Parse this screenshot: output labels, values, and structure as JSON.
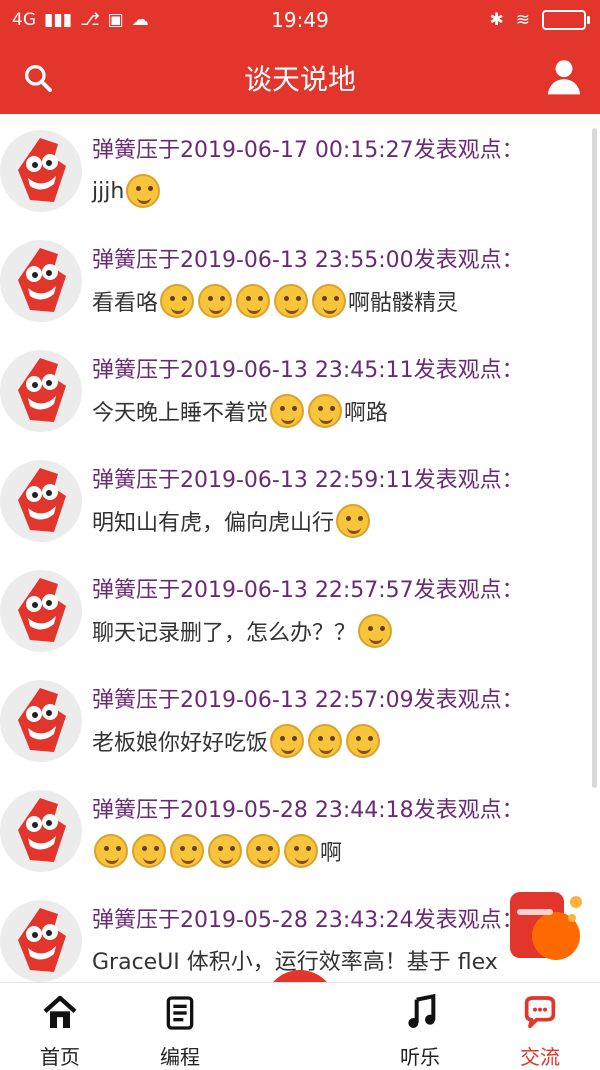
{
  "status_bar": {
    "network": "4G",
    "time": "19:49"
  },
  "header": {
    "title": "谈天说地"
  },
  "posts": [
    {
      "meta": "弹簧压于2019-06-17 00:15:27发表观点：",
      "text": "jjjh",
      "emoji_after": [
        "confused-face"
      ]
    },
    {
      "meta": "弹簧压于2019-06-13 23:55:00发表观点：",
      "text_before": "看看咯",
      "emoji_after": [
        "smile-face",
        "grin-face",
        "smile-face",
        "confused-face",
        "confused-face"
      ],
      "text_after": "啊骷髅精灵"
    },
    {
      "meta": "弹簧压于2019-06-13 23:45:11发表观点：",
      "text_before": "今天晚上睡不着觉",
      "emoji_after": [
        "laugh-face",
        "shock-face"
      ],
      "text_after": "啊路"
    },
    {
      "meta": "弹簧压于2019-06-13 22:59:11发表观点：",
      "text_before": "明知山有虎，偏向虎山行",
      "emoji_after": [
        "grin-face"
      ]
    },
    {
      "meta": "弹簧压于2019-06-13 22:57:57发表观点：",
      "text_before": "聊天记录删了，怎么办？？",
      "emoji_after": [
        "grin-face"
      ]
    },
    {
      "meta": "弹簧压于2019-06-13 22:57:09发表观点：",
      "text_before": "老板娘你好好吃饭",
      "emoji_after": [
        "confused-face",
        "smile-face",
        "laugh-face"
      ]
    },
    {
      "meta": "弹簧压于2019-05-28 23:44:18发表观点：",
      "text_before": "",
      "emoji_after": [
        "cry-face",
        "confused-face",
        "shock-face",
        "smile-face",
        "laugh-face",
        "grin-face"
      ],
      "text_after": "啊"
    },
    {
      "meta": "弹簧压于2019-05-28 23:43:24发表观点：",
      "text_before": "GraceUI 体积小，运行效率高！基于 flex"
    }
  ],
  "tabs": [
    {
      "label": "首页",
      "icon": "home-icon"
    },
    {
      "label": "编程",
      "icon": "document-icon"
    },
    {
      "label": "听乐",
      "icon": "music-icon"
    },
    {
      "label": "交流",
      "icon": "chat-icon"
    }
  ],
  "colors": {
    "accent": "#e2352b",
    "meta_text": "#6b2a75"
  }
}
